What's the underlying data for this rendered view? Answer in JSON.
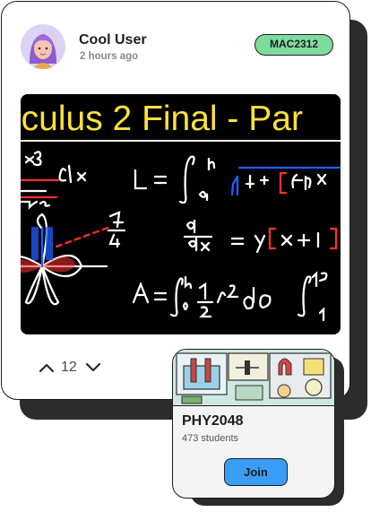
{
  "post": {
    "user_name": "Cool User",
    "timestamp": "2 hours ago",
    "course_tag": "MAC2312",
    "video_title": "lculus 2 Final - Par",
    "vote_count": "12"
  },
  "course_card": {
    "code": "PHY2048",
    "student_count": "473",
    "students_label": "students",
    "join_label": "Join"
  },
  "colors": {
    "badge_green": "#7ddc9c",
    "join_blue": "#3a9df5",
    "video_title_yellow": "#ffe23a",
    "shadow": "#2c2c2c"
  },
  "icons": [
    "avatar",
    "upvote-icon",
    "downvote-icon"
  ]
}
